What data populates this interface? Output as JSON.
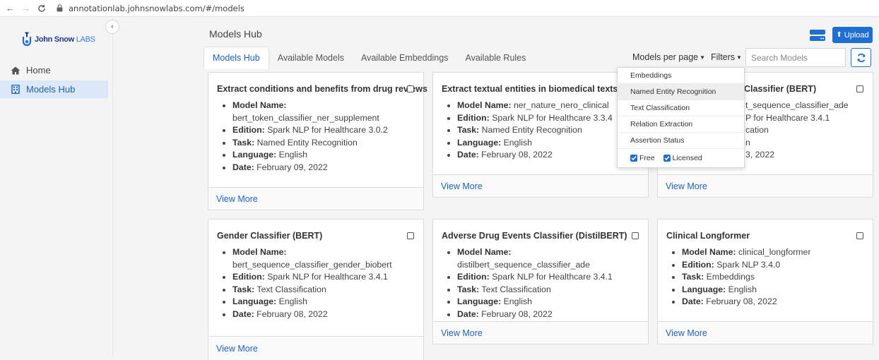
{
  "browser": {
    "url": "annotationlab.johnsnowlabs.com/#/models"
  },
  "sidebar": {
    "logo": {
      "name": "John Snow",
      "suffix": "LABS"
    },
    "items": [
      {
        "label": "Home",
        "icon": "home-icon"
      },
      {
        "label": "Models Hub",
        "icon": "building-icon",
        "active": true
      }
    ]
  },
  "header": {
    "title": "Models Hub",
    "upload_label": "Upload"
  },
  "tabs": [
    {
      "label": "Models Hub",
      "active": true
    },
    {
      "label": "Available Models"
    },
    {
      "label": "Available Embeddings"
    },
    {
      "label": "Available Rules"
    }
  ],
  "toolbar": {
    "models_per_page": "Models per page",
    "filters": "Filters",
    "search_placeholder": "Search Models"
  },
  "dropdown": {
    "items": [
      "Embeddings",
      "Named Entity Recognition",
      "Text Classification",
      "Relation Extraction",
      "Assertion Status"
    ],
    "hovered_index": 1,
    "checks": [
      {
        "label": "Free",
        "checked": true
      },
      {
        "label": "Licensed",
        "checked": true
      }
    ]
  },
  "field_labels": {
    "model_name": "Model Name:",
    "edition": "Edition:",
    "task": "Task:",
    "language": "Language:",
    "date": "Date:"
  },
  "view_more": "View More",
  "cards": [
    {
      "title": "Extract conditions and benefits from drug reviews",
      "model_name": "bert_token_classifier_ner_supplement",
      "edition": "Spark NLP for Healthcare 3.0.2",
      "task": "Named Entity Recognition",
      "language": "English",
      "date": "February 09, 2022"
    },
    {
      "title": "Extract textual entities in biomedical texts",
      "model_name": "ner_nature_nero_clinical",
      "edition": "Spark NLP for Healthcare 3.3.4",
      "task": "Named Entity Recognition",
      "language": "English",
      "date": "February 08, 2022"
    },
    {
      "title": "Classifier (BERT)",
      "model_name": "t_sequence_classifier_ade",
      "edition": "P for Healthcare 3.4.1",
      "task": "cation",
      "language": "n",
      "date": "3, 2022"
    },
    {
      "title": "Gender Classifier (BERT)",
      "model_name": "bert_sequence_classifier_gender_biobert",
      "edition": "Spark NLP for Healthcare 3.4.1",
      "task": "Text Classification",
      "language": "English",
      "date": "February 08, 2022"
    },
    {
      "title": "Adverse Drug Events Classifier (DistilBERT)",
      "model_name": "distilbert_sequence_classifier_ade",
      "edition": "Spark NLP for Healthcare 3.4.1",
      "task": "Text Classification",
      "language": "English",
      "date": "February 08, 2022"
    },
    {
      "title": "Clinical Longformer",
      "model_name": "clinical_longformer",
      "edition": "Spark NLP 3.4.0",
      "task": "Embeddings",
      "language": "English",
      "date": "February 08, 2022"
    }
  ],
  "colors": {
    "primary": "#1f6fd1",
    "link": "#1f62b5",
    "active_bg": "#dce8f7"
  }
}
